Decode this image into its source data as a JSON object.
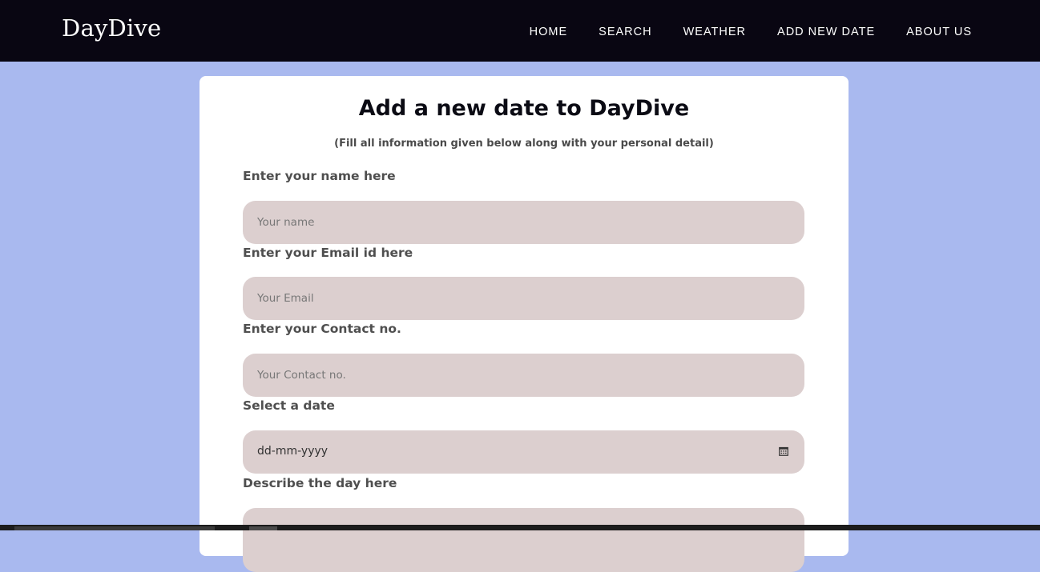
{
  "navbar": {
    "brand": "DayDive",
    "links": [
      "HOME",
      "SEARCH",
      "WEATHER",
      "ADD NEW DATE",
      "ABOUT US"
    ]
  },
  "form": {
    "title": "Add a new date to DayDive",
    "subtitle": "(Fill all information given below along with your personal detail)",
    "fields": [
      {
        "label": "Enter your name here",
        "placeholder": "Your name",
        "value": ""
      },
      {
        "label": "Enter your Email id here",
        "placeholder": "Your Email",
        "value": ""
      },
      {
        "label": "Enter your Contact no.",
        "placeholder": "Your Contact no.",
        "value": ""
      },
      {
        "label": "Select a date",
        "placeholder": "dd-mm-yyyy",
        "value": ""
      },
      {
        "label": "Describe the day here",
        "placeholder": "",
        "value": ""
      }
    ]
  },
  "colors": {
    "page_background": "#a9b9ef",
    "navbar_background": "#090612",
    "card_background": "#ffffff",
    "input_background": "#dccfcf"
  },
  "icons": {
    "date_picker": "calendar-icon"
  }
}
